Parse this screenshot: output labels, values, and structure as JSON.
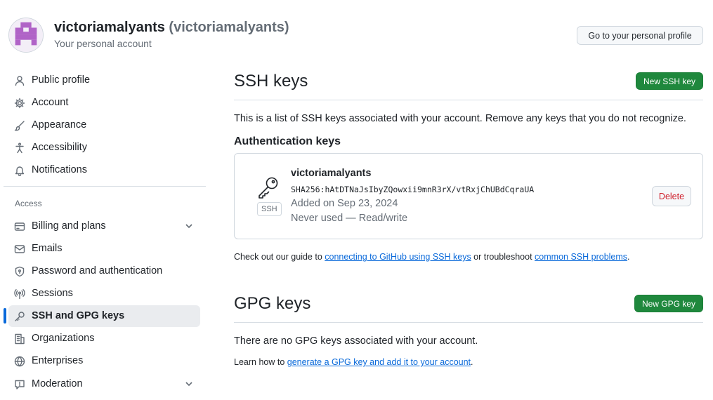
{
  "header": {
    "display_name": "victoriamalyants",
    "login": "(victoriamalyants)",
    "subtitle": "Your personal account",
    "profile_button": "Go to your personal profile"
  },
  "sidebar": {
    "items": [
      {
        "label": "Public profile",
        "icon": "person-icon"
      },
      {
        "label": "Account",
        "icon": "gear-icon"
      },
      {
        "label": "Appearance",
        "icon": "paintbrush-icon"
      },
      {
        "label": "Accessibility",
        "icon": "accessibility-icon"
      },
      {
        "label": "Notifications",
        "icon": "bell-icon"
      }
    ],
    "access_label": "Access",
    "access_items": [
      {
        "label": "Billing and plans",
        "icon": "credit-card-icon",
        "expandable": true
      },
      {
        "label": "Emails",
        "icon": "mail-icon"
      },
      {
        "label": "Password and authentication",
        "icon": "shield-lock-icon"
      },
      {
        "label": "Sessions",
        "icon": "broadcast-icon"
      },
      {
        "label": "SSH and GPG keys",
        "icon": "key-icon",
        "active": true
      },
      {
        "label": "Organizations",
        "icon": "organization-icon"
      },
      {
        "label": "Enterprises",
        "icon": "globe-icon"
      },
      {
        "label": "Moderation",
        "icon": "report-icon",
        "expandable": true
      }
    ]
  },
  "ssh": {
    "title": "SSH keys",
    "new_button": "New SSH key",
    "description": "This is a list of SSH keys associated with your account. Remove any keys that you do not recognize.",
    "auth_title": "Authentication keys",
    "key": {
      "name": "victoriamalyants",
      "fingerprint": "SHA256:hAtDTNaJsIbyZQowxii9mnR3rX/vtRxjChUBdCqraUA",
      "added": "Added on Sep 23, 2024",
      "usage": "Never used — Read/write",
      "badge": "SSH",
      "delete_button": "Delete"
    },
    "guide_prefix": "Check out our guide to ",
    "guide_link": "connecting to GitHub using SSH keys",
    "guide_middle": " or troubleshoot ",
    "guide_link2": "common SSH problems",
    "guide_suffix": "."
  },
  "gpg": {
    "title": "GPG keys",
    "new_button": "New GPG key",
    "empty_text": "There are no GPG keys associated with your account.",
    "learn_prefix": "Learn how to ",
    "learn_link": "generate a GPG key and add it to your account",
    "learn_suffix": "."
  },
  "colors": {
    "primary_green": "#1f883d",
    "link_blue": "#0969da",
    "danger_red": "#cf222e",
    "active_bar": "#0969da"
  }
}
